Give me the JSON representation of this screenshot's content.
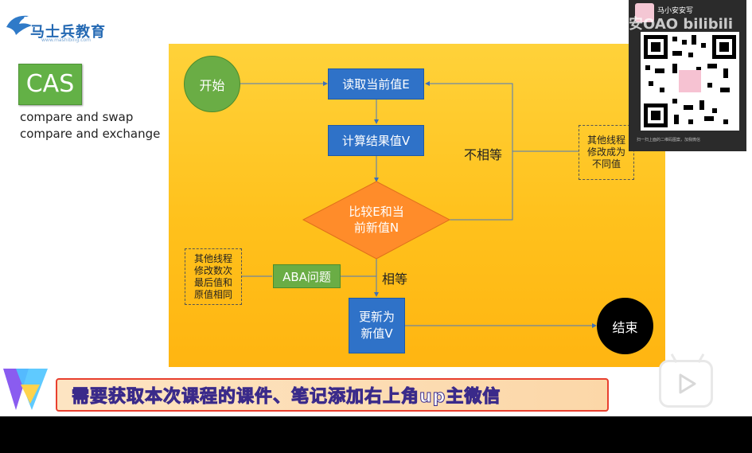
{
  "brand": {
    "logo_text": "马士兵教育",
    "logo_sub": "www.mashibing.com"
  },
  "cas": {
    "title": "CAS",
    "line1": "compare and swap",
    "line2": "compare and exchange"
  },
  "flow": {
    "start": "开始",
    "read": "读取当前值E",
    "compute": "计算结果值V",
    "compare_l1": "比较E和当",
    "compare_l2": "前新值N",
    "update_l1": "更新为",
    "update_l2": "新值V",
    "end": "结束",
    "aba": "ABA问题",
    "not_equal": "不相等",
    "equal": "相等",
    "note_right_l1": "其他线程",
    "note_right_l2": "修改成为",
    "note_right_l3": "不同值",
    "note_left_l1": "其他线程",
    "note_left_l2": "修改数次",
    "note_left_l3": "最后值和",
    "note_left_l4": "原值相同"
  },
  "overlay": {
    "uploader": "马小安安写",
    "watermark": "安OAO bilibili",
    "qr_caption": "扫一扫上面的二维码图案，加我微信"
  },
  "banner": {
    "text": "需要获取本次课程的课件、笔记添加右上角up主微信"
  },
  "colors": {
    "panel": "#ffc11c",
    "flow_box": "#2f72c8",
    "start": "#6aad45",
    "decision": "#ff8c2a",
    "end": "#000000"
  }
}
